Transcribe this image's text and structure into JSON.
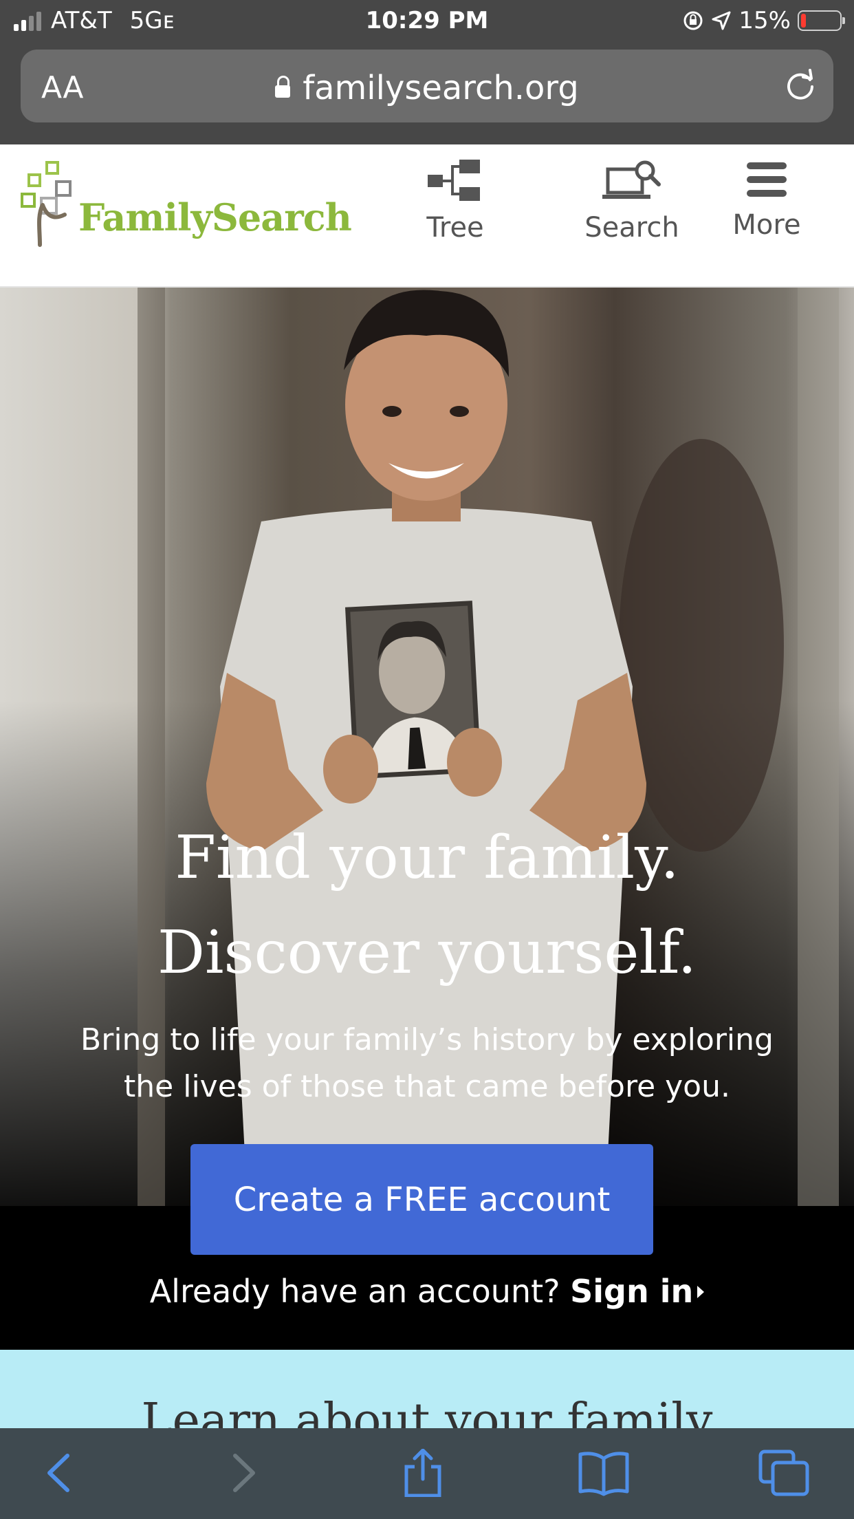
{
  "status_bar": {
    "carrier": "AT&T",
    "network": "5Gᴇ",
    "time": "10:29 PM",
    "battery": "15%",
    "battery_level": 0.15
  },
  "browser": {
    "text_size_label": "AA",
    "url": "familysearch.org"
  },
  "site_header": {
    "logo_text": "FamilySearch",
    "nav": [
      {
        "label": "Tree",
        "icon": "tree-icon"
      },
      {
        "label": "Search",
        "icon": "search-icon"
      },
      {
        "label": "More",
        "icon": "menu-icon"
      }
    ]
  },
  "hero": {
    "headline_line1": "Find your family.",
    "headline_line2": "Discover yourself.",
    "subtitle_line1": "Bring to life your family’s history by exploring",
    "subtitle_line2": "the lives of those that came before you.",
    "cta_label": "Create a FREE account",
    "signin_prompt": "Already have an account?",
    "signin_link": "Sign in"
  },
  "next_section": {
    "title": "Learn about your family"
  },
  "colors": {
    "brand_green": "#8cb83c",
    "cta_blue": "#4169d6",
    "section_cyan": "#b8ecf6",
    "toolbar_blue": "#4f8fe8"
  },
  "toolbar": {
    "icons": [
      "back-icon",
      "forward-icon",
      "share-icon",
      "bookmarks-icon",
      "tabs-icon"
    ]
  }
}
